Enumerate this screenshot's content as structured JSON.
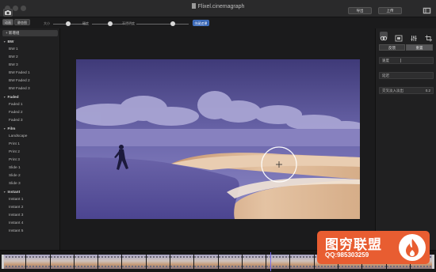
{
  "window": {
    "title": "Flixel.cinemagraph"
  },
  "toolbar": {
    "view_btn_1": "动画",
    "view_btn_2": "静态图",
    "slider_1_label": "大小",
    "slider_1_value": 0.45,
    "slider_2_label": "硬度",
    "slider_2_value": 0.55,
    "slider_3_label": "不透明度",
    "slider_3_value": 0.7,
    "mask_btn": "隐藏遮罩",
    "export_label": "导出",
    "upload_label": "上传"
  },
  "sidebar": {
    "new_preset_label": "+ 新增组",
    "groups": [
      {
        "title": "BW",
        "items": [
          "BW 1",
          "BW 2",
          "BW 3",
          "BW Faded 1",
          "BW Faded 2",
          "BW Faded 3"
        ]
      },
      {
        "title": "Faded",
        "items": [
          "Faded 1",
          "Faded 2",
          "Faded 3"
        ]
      },
      {
        "title": "Film",
        "items": [
          "Landscape",
          "Print 1",
          "Print 2",
          "Print 3",
          "Slide 1",
          "Slide 2",
          "Slide 3"
        ]
      },
      {
        "title": "Instant",
        "items": [
          "Instant 1",
          "Instant 2",
          "Instant 3",
          "Instant 4",
          "Instant 5"
        ]
      }
    ]
  },
  "right_panel": {
    "tab_1": "反馈",
    "tab_2": "重置",
    "field_speed": "速度",
    "field_delay": "延迟",
    "field_crossfade_label": "交叉淡入淡出",
    "field_crossfade_value": "0.2"
  },
  "watermark": {
    "title": "图穷联盟",
    "sub": "QQ:985303259"
  },
  "colors": {
    "accent": "#2f5fb0",
    "mask_overlay": "#5a52c8",
    "watermark": "#e85d31",
    "playhead": "#7a6ff0"
  }
}
